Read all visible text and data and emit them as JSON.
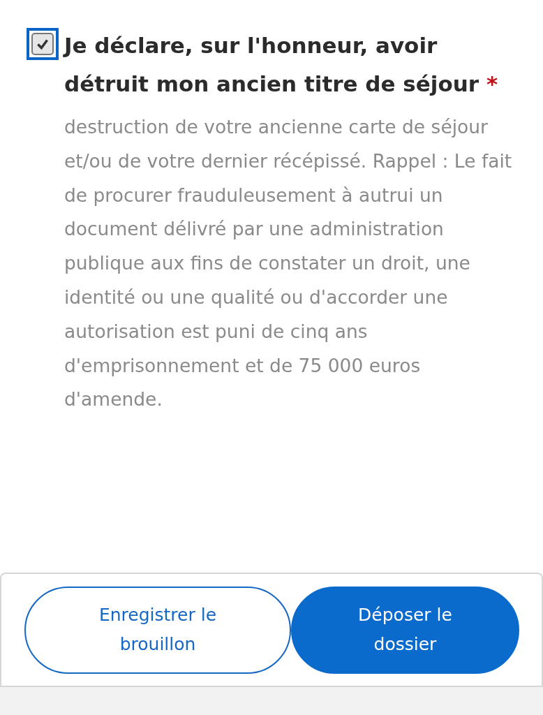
{
  "declaration": {
    "checked": true,
    "focused": true,
    "label": "Je déclare, sur l'honneur, avoir détruit mon ancien titre de séjour",
    "required_mark": "*",
    "description": "destruction de votre ancienne carte de séjour et/ou de votre dernier récépissé. Rappel : Le fait de procurer frauduleusement à autrui un document délivré par une administration publique aux fins de constater un droit, une identité ou une qualité ou d'accorder une autorisation est puni de cinq ans d'emprisonnement et de 75 000 euros d'amende."
  },
  "buttons": [
    {
      "label": "Enregistrer le brouillon",
      "kind": "secondary"
    },
    {
      "label": "Déposer le dossier",
      "kind": "primary"
    }
  ]
}
